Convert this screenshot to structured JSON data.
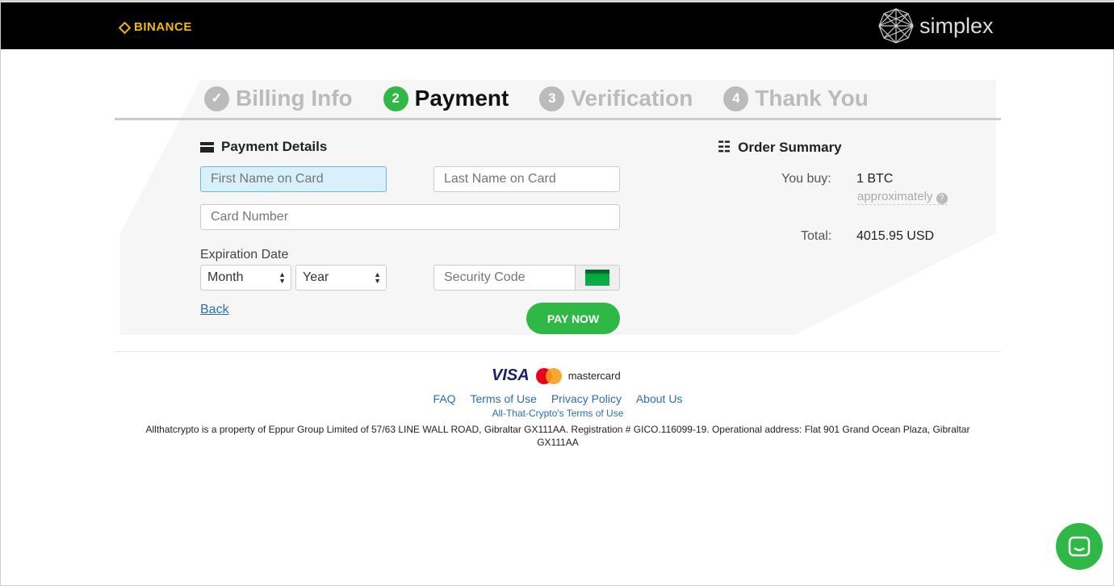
{
  "header": {
    "brand": "BINANCE",
    "partner": "simplex"
  },
  "steps": [
    {
      "label": "Billing Info",
      "marker": "✓"
    },
    {
      "label": "Payment",
      "marker": "2"
    },
    {
      "label": "Verification",
      "marker": "3"
    },
    {
      "label": "Thank You",
      "marker": "4"
    }
  ],
  "active_step": "Payment",
  "payment": {
    "title": "Payment Details",
    "first_name_placeholder": "First Name on Card",
    "last_name_placeholder": "Last Name on Card",
    "card_number_placeholder": "Card Number",
    "expiration_label": "Expiration Date",
    "month": "Month",
    "year": "Year",
    "security_placeholder": "Security Code",
    "back": "Back",
    "pay_now": "PAY NOW"
  },
  "order": {
    "title": "Order Summary",
    "you_buy_label": "You buy:",
    "you_buy_value": "1 BTC",
    "approx": "approximately",
    "total_label": "Total:",
    "total_value": "4015.95 USD"
  },
  "footer": {
    "visa": "VISA",
    "mastercard": "mastercard",
    "links": [
      "FAQ",
      "Terms of Use",
      "Privacy Policy",
      "About Us"
    ],
    "atc_terms": "All-That-Crypto's Terms of Use",
    "legal": "Allthatcrypto is a property of Eppur Group Limited of 57/63 LINE WALL ROAD, Gibraltar GX111AA. Registration # GICO.116099-19. Operational address: Flat 901 Grand Ocean Plaza, Gibraltar GX111AA"
  },
  "colors": {
    "accent": "#2fb845",
    "link": "#2a6fb0",
    "binance": "#f0b90b"
  }
}
